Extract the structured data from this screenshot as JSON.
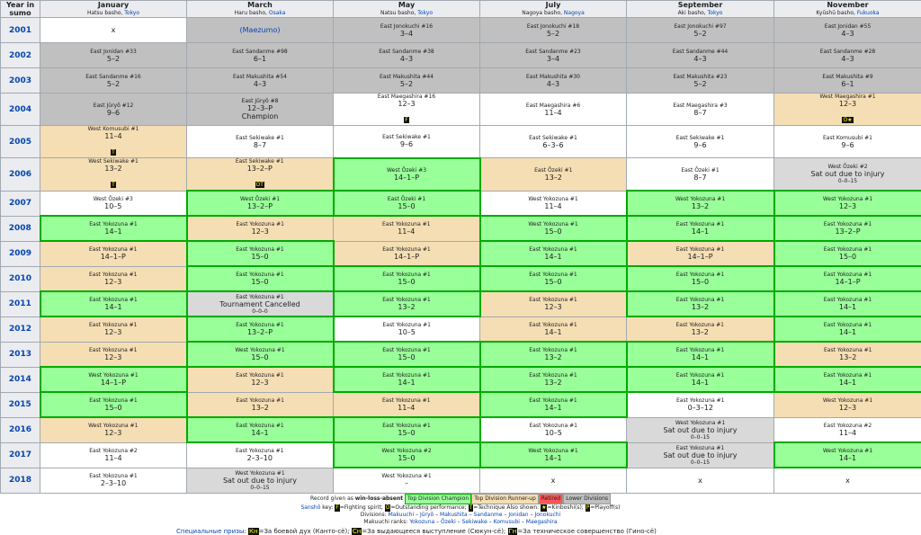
{
  "header": {
    "year_col": "Year in sumo",
    "months": [
      {
        "name": "January",
        "basho": "Hatsu basho, ",
        "city": "Tokyo"
      },
      {
        "name": "March",
        "basho": "Haru basho, ",
        "city": "Osaka"
      },
      {
        "name": "May",
        "basho": "Natsu basho, ",
        "city": "Tokyo"
      },
      {
        "name": "July",
        "basho": "Nagoya basho, ",
        "city": "Nagoya"
      },
      {
        "name": "September",
        "basho": "Aki basho, ",
        "city": "Tokyo"
      },
      {
        "name": "November",
        "basho": "Kyūshū basho, ",
        "city": "Fukuoka"
      }
    ]
  },
  "rows": [
    {
      "year": "2001",
      "cells": [
        {
          "c": "nd",
          "s": "x"
        },
        {
          "c": "lo",
          "s": "(Maezumo)",
          "link": true
        },
        {
          "c": "lo",
          "r": "East Jonokuchi #16",
          "s": "3–4"
        },
        {
          "c": "lo",
          "r": "East Jonokuchi #18",
          "s": "5–2"
        },
        {
          "c": "lo",
          "r": "East Jonokuchi #97",
          "s": "5–2"
        },
        {
          "c": "lo",
          "r": "East Jonidan #55",
          "s": "4–3"
        }
      ]
    },
    {
      "year": "2002",
      "cells": [
        {
          "c": "lo",
          "r": "East Jonidan #33",
          "s": "5–2"
        },
        {
          "c": "lo",
          "r": "East Sandanme #98",
          "s": "6–1"
        },
        {
          "c": "lo",
          "r": "East Sandanme #38",
          "s": "4–3"
        },
        {
          "c": "lo",
          "r": "East Sandanme #23",
          "s": "3–4"
        },
        {
          "c": "lo",
          "r": "East Sandanme #44",
          "s": "4–3"
        },
        {
          "c": "lo",
          "r": "East Sandanme #28",
          "s": "4–3"
        }
      ]
    },
    {
      "year": "2003",
      "cells": [
        {
          "c": "lo",
          "r": "East Sandanme #16",
          "s": "5–2"
        },
        {
          "c": "lo",
          "r": "East Makushita #54",
          "s": "4–3"
        },
        {
          "c": "lo",
          "r": "East Makushita #44",
          "s": "5–2"
        },
        {
          "c": "lo",
          "r": "East Makushita #30",
          "s": "4–3"
        },
        {
          "c": "lo",
          "r": "East Makushita #23",
          "s": "5–2"
        },
        {
          "c": "lo",
          "r": "East Makushita #9",
          "s": "6–1"
        }
      ]
    },
    {
      "year": "2004",
      "cells": [
        {
          "c": "lo",
          "r": "East Jūryō #12",
          "s": "9–6"
        },
        {
          "c": "lo",
          "r": "East Jūryō #8",
          "s": "12–3–P",
          "n": "Champion"
        },
        {
          "c": "nd",
          "r": "East Maegashira #16",
          "s": "12–3",
          "p": "F"
        },
        {
          "c": "nd",
          "r": "East Maegashira #6",
          "s": "11–4"
        },
        {
          "c": "nd",
          "r": "East Maegashira #3",
          "s": "8–7"
        },
        {
          "c": "ru",
          "r": "West Maegashira #1",
          "s": "12–3",
          "p": "O★"
        }
      ]
    },
    {
      "year": "2005",
      "cells": [
        {
          "c": "ru",
          "r": "West Komusubi #1",
          "s": "11–4",
          "p": "T"
        },
        {
          "c": "nd",
          "r": "East Sekiwake #1",
          "s": "8–7"
        },
        {
          "c": "nd",
          "r": "East Sekiwake #1",
          "s": "9–6"
        },
        {
          "c": "nd",
          "r": "East Sekiwake #1",
          "s": "6–3–6"
        },
        {
          "c": "nd",
          "r": "East Sekiwake #1",
          "s": "9–6"
        },
        {
          "c": "nd",
          "r": "East Komusubi #1",
          "s": "9–6"
        }
      ]
    },
    {
      "year": "2006",
      "cells": [
        {
          "c": "ru",
          "r": "West Sekiwake #1",
          "s": "13–2",
          "p": "T"
        },
        {
          "c": "ru",
          "r": "East Sekiwake #1",
          "s": "13–2–P",
          "p": "OT"
        },
        {
          "c": "ch",
          "r": "West Ōzeki #3",
          "s": "14–1–P"
        },
        {
          "c": "ru",
          "r": "East Ōzeki #1",
          "s": "13–2"
        },
        {
          "c": "nd",
          "r": "East Ōzeki #1",
          "s": "8–7"
        },
        {
          "c": "sl",
          "r": "West Ōzeki #2",
          "s": "Sat out due to injury",
          "n": "0–0–15"
        }
      ]
    },
    {
      "year": "2007",
      "cells": [
        {
          "c": "nd",
          "r": "West Ōzeki #3",
          "s": "10–5"
        },
        {
          "c": "ch",
          "r": "West Ōzeki #1",
          "s": "13–2–P"
        },
        {
          "c": "ch",
          "r": "East Ōzeki #1",
          "s": "15–0"
        },
        {
          "c": "nd",
          "r": "West Yokozuna #1",
          "s": "11–4"
        },
        {
          "c": "ch",
          "r": "West Yokozuna #1",
          "s": "13–2"
        },
        {
          "c": "ch",
          "r": "West Yokozuna #1",
          "s": "12–3"
        }
      ]
    },
    {
      "year": "2008",
      "cells": [
        {
          "c": "ch",
          "r": "East Yokozuna #1",
          "s": "14–1"
        },
        {
          "c": "ru",
          "r": "East Yokozuna #1",
          "s": "12–3"
        },
        {
          "c": "ru",
          "r": "East Yokozuna #1",
          "s": "11–4"
        },
        {
          "c": "ch",
          "r": "West Yokozuna #1",
          "s": "15–0"
        },
        {
          "c": "ch",
          "r": "East Yokozuna #1",
          "s": "14–1"
        },
        {
          "c": "ch",
          "r": "East Yokozuna #1",
          "s": "13–2–P"
        }
      ]
    },
    {
      "year": "2009",
      "cells": [
        {
          "c": "ru",
          "r": "East Yokozuna #1",
          "s": "14–1–P"
        },
        {
          "c": "ch",
          "r": "East Yokozuna #1",
          "s": "15–0"
        },
        {
          "c": "ru",
          "r": "East Yokozuna #1",
          "s": "14–1–P"
        },
        {
          "c": "ch",
          "r": "East Yokozuna #1",
          "s": "14–1"
        },
        {
          "c": "ru",
          "r": "East Yokozuna #1",
          "s": "14–1–P"
        },
        {
          "c": "ch",
          "r": "East Yokozuna #1",
          "s": "15–0"
        }
      ]
    },
    {
      "year": "2010",
      "cells": [
        {
          "c": "ru",
          "r": "East Yokozuna #1",
          "s": "12–3"
        },
        {
          "c": "ch",
          "r": "East Yokozuna #1",
          "s": "15–0"
        },
        {
          "c": "ch",
          "r": "East Yokozuna #1",
          "s": "15–0"
        },
        {
          "c": "ch",
          "r": "East Yokozuna #1",
          "s": "15–0"
        },
        {
          "c": "ch",
          "r": "East Yokozuna #1",
          "s": "15–0"
        },
        {
          "c": "ch",
          "r": "East Yokozuna #1",
          "s": "14–1–P"
        }
      ]
    },
    {
      "year": "2011",
      "cells": [
        {
          "c": "ch",
          "r": "East Yokozuna #1",
          "s": "14–1"
        },
        {
          "c": "sl",
          "r": "East Yokozuna #1",
          "s": "Tournament Cancelled",
          "n": "0–0–0"
        },
        {
          "c": "ch",
          "r": "East Yokozuna #1",
          "s": "13–2"
        },
        {
          "c": "ru",
          "r": "East Yokozuna #1",
          "s": "12–3"
        },
        {
          "c": "ch",
          "r": "East Yokozuna #1",
          "s": "13–2"
        },
        {
          "c": "ch",
          "r": "East Yokozuna #1",
          "s": "14–1"
        }
      ]
    },
    {
      "year": "2012",
      "cells": [
        {
          "c": "ru",
          "r": "East Yokozuna #1",
          "s": "12–3"
        },
        {
          "c": "ch",
          "r": "East Yokozuna #1",
          "s": "13–2–P"
        },
        {
          "c": "nd",
          "r": "East Yokozuna #1",
          "s": "10–5"
        },
        {
          "c": "ru",
          "r": "East Yokozuna #1",
          "s": "14–1"
        },
        {
          "c": "ru",
          "r": "East Yokozuna #1",
          "s": "13–2"
        },
        {
          "c": "ch",
          "r": "East Yokozuna #1",
          "s": "14–1"
        }
      ]
    },
    {
      "year": "2013",
      "cells": [
        {
          "c": "ru",
          "r": "East Yokozuna #1",
          "s": "12–3"
        },
        {
          "c": "ch",
          "r": "West Yokozuna #1",
          "s": "15–0"
        },
        {
          "c": "ch",
          "r": "East Yokozuna #1",
          "s": "15–0"
        },
        {
          "c": "ch",
          "r": "East Yokozuna #1",
          "s": "13–2"
        },
        {
          "c": "ch",
          "r": "East Yokozuna #1",
          "s": "14–1"
        },
        {
          "c": "ru",
          "r": "East Yokozuna #1",
          "s": "13–2"
        }
      ]
    },
    {
      "year": "2014",
      "cells": [
        {
          "c": "ch",
          "r": "West Yokozuna #1",
          "s": "14–1–P"
        },
        {
          "c": "ru",
          "r": "East Yokozuna #1",
          "s": "12–3"
        },
        {
          "c": "ch",
          "r": "East Yokozuna #1",
          "s": "14–1"
        },
        {
          "c": "ch",
          "r": "East Yokozuna #1",
          "s": "13–2"
        },
        {
          "c": "ch",
          "r": "East Yokozuna #1",
          "s": "14–1"
        },
        {
          "c": "ch",
          "r": "East Yokozuna #1",
          "s": "14–1"
        }
      ]
    },
    {
      "year": "2015",
      "cells": [
        {
          "c": "ch",
          "r": "East Yokozuna #1",
          "s": "15–0"
        },
        {
          "c": "ru",
          "r": "East Yokozuna #1",
          "s": "13–2"
        },
        {
          "c": "ru",
          "r": "East Yokozuna #1",
          "s": "11–4"
        },
        {
          "c": "ch",
          "r": "East Yokozuna #1",
          "s": "14–1"
        },
        {
          "c": "nd",
          "r": "East Yokozuna #1",
          "s": "0–3–12"
        },
        {
          "c": "ru",
          "r": "West Yokozuna #1",
          "s": "12–3"
        }
      ]
    },
    {
      "year": "2016",
      "cells": [
        {
          "c": "ru",
          "r": "West Yokozuna #1",
          "s": "12–3"
        },
        {
          "c": "ch",
          "r": "East Yokozuna #1",
          "s": "14–1"
        },
        {
          "c": "ch",
          "r": "East Yokozuna #1",
          "s": "15–0"
        },
        {
          "c": "nd",
          "r": "East Yokozuna #1",
          "s": "10–5"
        },
        {
          "c": "sl",
          "r": "West Yokozuna #1",
          "s": "Sat out due to injury",
          "n": "0–0–15"
        },
        {
          "c": "nd",
          "r": "East Yokozuna #2",
          "s": "11–4"
        }
      ]
    },
    {
      "year": "2017",
      "cells": [
        {
          "c": "nd",
          "r": "East Yokozuna #2",
          "s": "11–4"
        },
        {
          "c": "nd",
          "r": "East Yokozuna #1",
          "s": "2–3–10"
        },
        {
          "c": "ch",
          "r": "West Yokozuna #2",
          "s": "15–0"
        },
        {
          "c": "ch",
          "r": "West Yokozuna #1",
          "s": "14–1"
        },
        {
          "c": "sl",
          "r": "East Yokozuna #1",
          "s": "Sat out due to injury",
          "n": "0–0–15"
        },
        {
          "c": "ch",
          "r": "West Yokozuna #1",
          "s": "14–1"
        }
      ]
    },
    {
      "year": "2018",
      "cells": [
        {
          "c": "nd",
          "r": "East Yokozuna #1",
          "s": "2–3–10"
        },
        {
          "c": "sl",
          "r": "West Yokozuna #1",
          "s": "Sat out due to injury",
          "n": "0–0–15"
        },
        {
          "c": "nd",
          "r": "West Yokozuna #1",
          "s": "–"
        },
        {
          "c": "nd",
          "s": "x"
        },
        {
          "c": "nd",
          "s": "x"
        },
        {
          "c": "nd",
          "s": "x"
        }
      ]
    }
  ],
  "legend": {
    "record_text": "Record given as ",
    "record_bold": "win-loss-absent",
    "champ": "Top Division Champion",
    "runner": "Top Division Runner-up",
    "retired": "Retired",
    "lower": "Lower Divisions",
    "sansho": "Sanshō",
    "sansho_key": " key: ",
    "f": "F",
    "f_text": "=Fighting spirit; ",
    "o": "O",
    "o_text": "=Outstanding performance; ",
    "t": "T",
    "t_text": "=Technique    Also shown: ",
    "k": "★",
    "k_text": "=Kinboshi(s); ",
    "p": "P",
    "p_text": "=Playoff(s)",
    "div_label": "Divisions: ",
    "divs": [
      "Makuuchi",
      "Jūryō",
      "Makushita",
      "Sandanme",
      "Jonidan",
      "Jonokuchi"
    ],
    "makuuchi_label": "Makuuchi ranks: ",
    "ranks": [
      "Yokozuna",
      "Ōzeki",
      "Sekiwake",
      "Komusubi",
      "Maegashira"
    ]
  },
  "footer": {
    "label": "Специальные призы",
    "k": "Кн",
    "k_text": "=За боевой дух (Канто-сё); ",
    "s": "Сн",
    "s_text": "=За выдающееся выступление (Сюкун-сё); ",
    "g": "Гн",
    "g_text": "=За техническое совершенство (Гино-сё)"
  }
}
